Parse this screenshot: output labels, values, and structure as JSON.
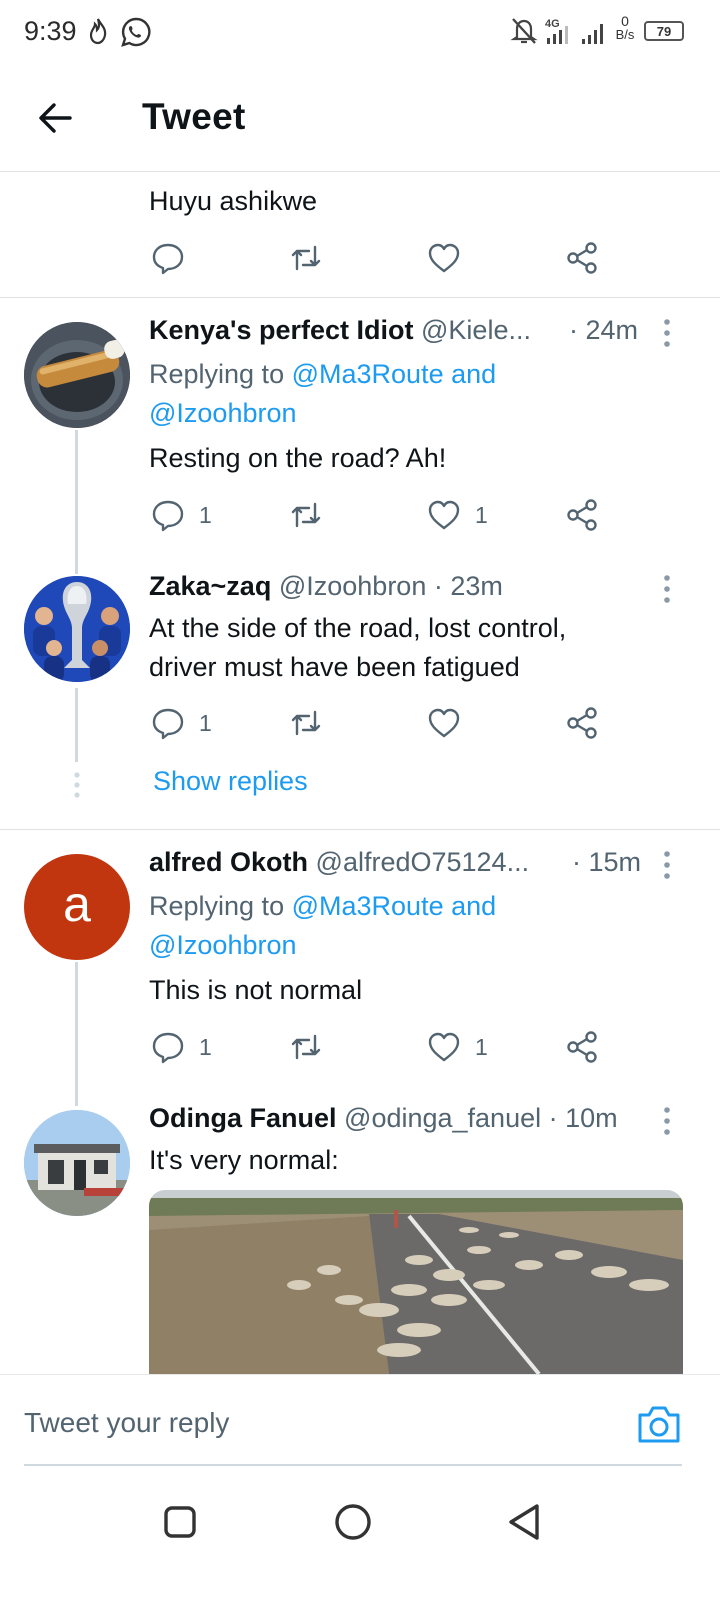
{
  "status_bar": {
    "time": "9:39",
    "net_speed_value": "0",
    "net_speed_unit": "B/s",
    "battery": "79",
    "network": "4G"
  },
  "header": {
    "title": "Tweet"
  },
  "top_tweet": {
    "text": "Huyu ashikwe"
  },
  "replies": [
    {
      "name": "Kenya's perfect Idiot",
      "handle": "@Kiele...",
      "time": "· 24m",
      "replying_prefix": "Replying to",
      "replying_to_line1": "@Ma3Route and",
      "replying_to_line2": "@Izoohbron",
      "text": "Resting on the road? Ah!",
      "reply_count": "1",
      "like_count": "1"
    },
    {
      "name": "Zaka~zaq",
      "handle": "@Izoohbron",
      "time": "· 23m",
      "text_line1": "At the side of the road, lost control,",
      "text_line2": "driver must have been fatigued",
      "reply_count": "1",
      "show_replies": "Show replies"
    },
    {
      "name": "alfred Okoth",
      "handle": "@alfredO75124...",
      "time": "· 15m",
      "avatar_letter": "a",
      "avatar_color": "#c1360e",
      "replying_prefix": "Replying to",
      "replying_to_line1": "@Ma3Route and",
      "replying_to_line2": "@Izoohbron",
      "text": "This is not normal",
      "reply_count": "1",
      "like_count": "1"
    },
    {
      "name": "Odinga Fanuel",
      "handle": "@odinga_fanuel",
      "time": "· 10m",
      "text": "It's very normal:"
    }
  ],
  "composer": {
    "placeholder": "Tweet your reply"
  },
  "colors": {
    "accent": "#1d9bf0",
    "muted": "#536471",
    "thread": "#cfd9de"
  },
  "icons": [
    "back-arrow-icon",
    "reply-icon",
    "retweet-icon",
    "like-icon",
    "share-icon",
    "more-icon",
    "camera-icon",
    "nav-recents-icon",
    "nav-home-icon",
    "nav-back-icon"
  ]
}
